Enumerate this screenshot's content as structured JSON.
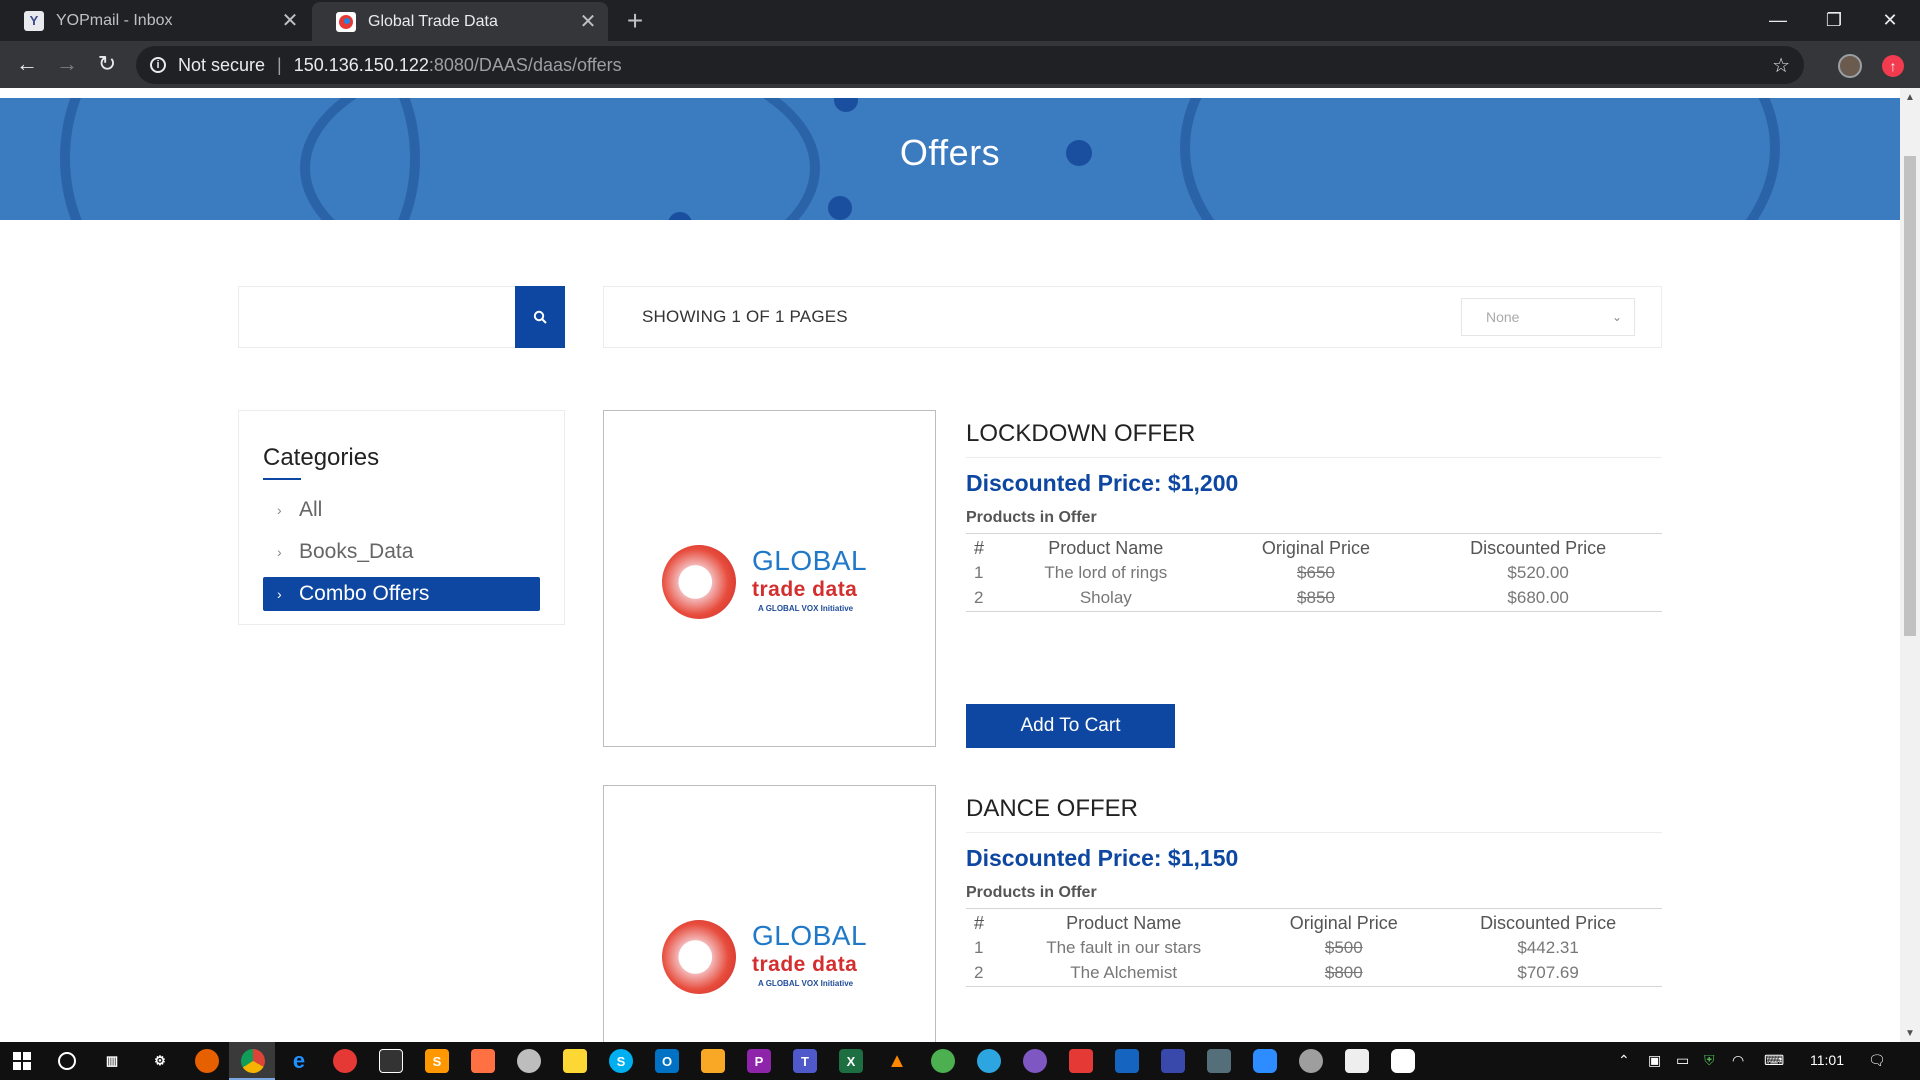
{
  "browser": {
    "tabs": [
      {
        "title": "YOPmail - Inbox",
        "favicon": "Y",
        "active": false
      },
      {
        "title": "Global Trade Data",
        "favicon": "globe-favicon",
        "active": true
      }
    ],
    "new_tab_icon": "+",
    "url": {
      "security_label": "Not secure",
      "host": "150.136.150.122",
      "path": ":8080/DAAS/daas/offers"
    },
    "window_controls": {
      "minimize": "—",
      "restore": "❐",
      "close": "✕"
    }
  },
  "page": {
    "banner_title": "Offers",
    "search": {
      "placeholder": "",
      "value": ""
    },
    "showing_text": "SHOWING 1 OF 1 PAGES",
    "sort_selected": "None",
    "categories": {
      "title": "Categories",
      "items": [
        {
          "label": "All",
          "active": false
        },
        {
          "label": "Books_Data",
          "active": false
        },
        {
          "label": "Combo Offers",
          "active": true
        }
      ]
    },
    "logo": {
      "line1": "GLOBAL",
      "line2": "trade data",
      "line3": "A GLOBAL VOX Initiative"
    },
    "table_headers": {
      "num": "#",
      "name": "Product Name",
      "original": "Original Price",
      "discounted": "Discounted Price"
    },
    "offers": [
      {
        "title": "LOCKDOWN OFFER",
        "price": "Discounted Price: $1,200",
        "products_label": "Products in Offer",
        "products": [
          {
            "num": "1",
            "name": "The lord of rings",
            "original": "$650",
            "discounted": "$520.00"
          },
          {
            "num": "2",
            "name": "Sholay",
            "original": "$850",
            "discounted": "$680.00"
          }
        ],
        "add_to_cart": "Add To Cart"
      },
      {
        "title": "DANCE OFFER",
        "price": "Discounted Price: $1,150",
        "products_label": "Products in Offer",
        "products": [
          {
            "num": "1",
            "name": "The fault in our stars",
            "original": "$500",
            "discounted": "$442.31"
          },
          {
            "num": "2",
            "name": "The Alchemist",
            "original": "$800",
            "discounted": "$707.69"
          }
        ]
      }
    ]
  },
  "taskbar": {
    "time": "11:01",
    "icons": [
      "windows-start-icon",
      "cortana-icon",
      "task-view-icon",
      "settings-icon",
      "firefox-icon",
      "chrome-icon",
      "edge-icon",
      "app-icon",
      "app-icon",
      "sublime-icon",
      "app-icon",
      "app-icon",
      "sticky-notes-icon",
      "skype-icon",
      "outlook-icon",
      "file-explorer-icon",
      "phpstorm-icon",
      "teams-icon",
      "excel-icon",
      "vlc-icon",
      "app-icon",
      "telegram-icon",
      "app-icon",
      "app-icon",
      "app-icon",
      "app-icon",
      "app-icon",
      "zoom-icon",
      "app-icon",
      "app-icon",
      "app-icon"
    ]
  },
  "colors": {
    "brand_blue": "#0d47a1",
    "banner_blue": "#3b7bbf",
    "chrome_dark": "#202124"
  }
}
